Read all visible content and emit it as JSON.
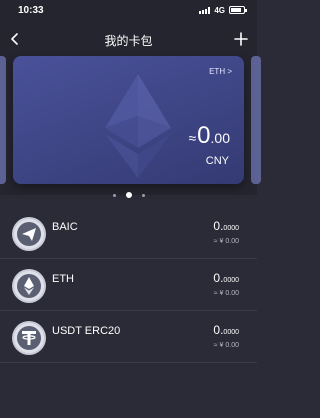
{
  "status_bar": {
    "time": "10:33",
    "network": "4G"
  },
  "nav": {
    "title": "我的卡包"
  },
  "card": {
    "network_link": "ETH >",
    "approx_sign": "≈",
    "balance_int": "0",
    "balance_dec": ".00",
    "currency": "CNY"
  },
  "assets": [
    {
      "name": "BAIC",
      "amount_int": "0.",
      "amount_dec": "0000",
      "fiat": "≈ ¥ 0.00",
      "icon": "paper-plane-icon"
    },
    {
      "name": "ETH",
      "amount_int": "0.",
      "amount_dec": "0000",
      "fiat": "≈ ¥ 0.00",
      "icon": "ethereum-icon"
    },
    {
      "name": "USDT ERC20",
      "amount_int": "0.",
      "amount_dec": "0000",
      "fiat": "≈ ¥ 0.00",
      "icon": "tether-icon"
    }
  ],
  "colors": {
    "background": "#2a2b36",
    "card": "#454c91",
    "text": "#ffffff",
    "muted": "#b5b6c2"
  }
}
